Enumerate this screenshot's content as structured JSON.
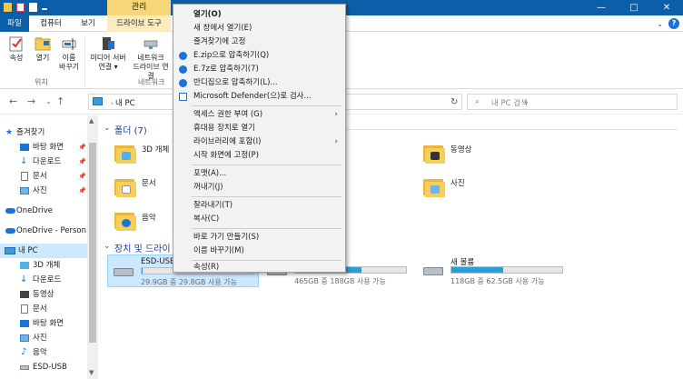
{
  "titlebar": {
    "context_tab": "관리",
    "minimize": "—",
    "maximize": "□",
    "close": "✕"
  },
  "ribbon_tabs": [
    {
      "label": "파일"
    },
    {
      "label": "컴퓨터"
    },
    {
      "label": "보기"
    },
    {
      "label": "드라이브 도구"
    }
  ],
  "ribbon": {
    "properties": "속성",
    "open": "열기",
    "rename_1": "이름",
    "rename_2": "바꾸기",
    "media_1": "미디어 서버",
    "media_2": "연결 ▾",
    "network_1": "네트워크",
    "network_2": "드라이브 연결",
    "group_location": "위치",
    "group_network": "네트워크"
  },
  "address": {
    "path": "내 PC",
    "search_placeholder": "내 PC 검색"
  },
  "navpane": {
    "items": [
      {
        "label": "즐겨찾기",
        "icon": "star-icon",
        "pinned": false
      },
      {
        "label": "바탕 화면",
        "icon": "desktop-icon",
        "pinned": true
      },
      {
        "label": "다운로드",
        "icon": "download-icon",
        "pinned": true
      },
      {
        "label": "문서",
        "icon": "document-icon",
        "pinned": true
      },
      {
        "label": "사진",
        "icon": "pictures-icon",
        "pinned": true
      },
      {
        "label": "OneDrive",
        "icon": "cloud-icon",
        "pinned": false
      },
      {
        "label": "OneDrive - Person",
        "icon": "cloud-icon",
        "pinned": false
      },
      {
        "label": "내 PC",
        "icon": "pc-icon",
        "pinned": false
      },
      {
        "label": "3D 개체",
        "icon": "cube-icon",
        "pinned": false
      },
      {
        "label": "다운로드",
        "icon": "download-icon",
        "pinned": false
      },
      {
        "label": "동영상",
        "icon": "video-icon",
        "pinned": false
      },
      {
        "label": "문서",
        "icon": "document-icon",
        "pinned": false
      },
      {
        "label": "바탕 화면",
        "icon": "desktop-icon",
        "pinned": false
      },
      {
        "label": "사진",
        "icon": "pictures-icon",
        "pinned": false
      },
      {
        "label": "음악",
        "icon": "music-icon",
        "pinned": false
      },
      {
        "label": "ESD-USB",
        "icon": "usb-drive-icon",
        "pinned": false
      }
    ],
    "pin_glyph": "📌"
  },
  "content": {
    "folders_header": "폴더 (7)",
    "folders": [
      {
        "label": "3D 개체"
      },
      {
        "label": "동영상"
      },
      {
        "label": "문서"
      },
      {
        "label": "사진"
      },
      {
        "label": "음악"
      }
    ],
    "drives_header": "장치 및 드라이",
    "drives": [
      {
        "name": "ESD-USB",
        "sub": "29.9GB 중 29.8GB 사용 가능",
        "used_fraction": 0.01
      },
      {
        "name": "",
        "sub": "465GB 중 188GB 사용 가능",
        "used_fraction": 0.6
      },
      {
        "name": "새 볼륨",
        "sub": "118GB 중 62.5GB 사용 가능",
        "used_fraction": 0.47
      }
    ]
  },
  "context_menu": {
    "items": [
      {
        "label": "열기(O)",
        "bold": true
      },
      {
        "label": "새 창에서 열기(E)"
      },
      {
        "label": "즐겨찾기에 고정"
      },
      {
        "label": "E.zip으로 압축하기(Q)",
        "icon": "bandizip-icon"
      },
      {
        "label": "E.7z로 압축하기(7)",
        "icon": "bandizip-icon"
      },
      {
        "label": "반디집으로 압축하기(L)...",
        "icon": "bandizip-icon"
      },
      {
        "label": "Microsoft Defender(으)로 검사...",
        "icon": "defender-icon"
      },
      {
        "label": "액세스 권한 부여 (G)",
        "submenu": true
      },
      {
        "label": "휴대용 장치로 열기"
      },
      {
        "label": "라이브러리에 포함(I)",
        "submenu": true
      },
      {
        "label": "시작 화면에 고정(P)"
      },
      {
        "label": "포맷(A)..."
      },
      {
        "label": "꺼내기(J)"
      },
      {
        "label": "잘라내기(T)"
      },
      {
        "label": "복사(C)"
      },
      {
        "label": "바로 가기 만들기(S)"
      },
      {
        "label": "이름 바꾸기(M)"
      },
      {
        "label": "속성(R)"
      }
    ]
  },
  "colors": {
    "accent": "#0b5ea8",
    "selection": "#cce8ff",
    "drive_fill": "#26a0da",
    "context_tab": "#f7d67a"
  }
}
